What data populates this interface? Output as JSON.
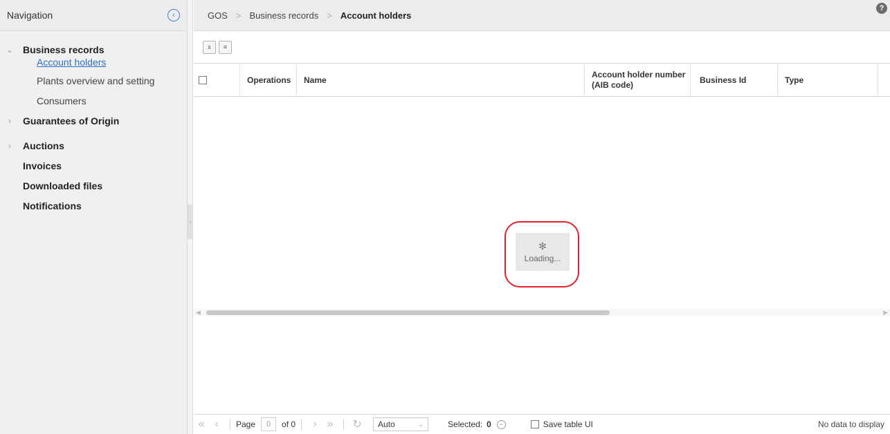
{
  "sidebar": {
    "title": "Navigation",
    "items": [
      {
        "label": "Business records",
        "expanded": true,
        "children": [
          "Account holders",
          "Plants overview and setting",
          "Consumers"
        ]
      },
      {
        "label": "Guarantees of Origin"
      },
      {
        "label": "Auctions"
      },
      {
        "label": "Invoices"
      },
      {
        "label": "Downloaded files"
      },
      {
        "label": "Notifications"
      }
    ]
  },
  "breadcrumb": [
    "GOS",
    "Business records",
    "Account holders"
  ],
  "grid": {
    "columns": [
      "Operations",
      "Name",
      "Account holder number (AIB code)",
      "Business Id",
      "Type"
    ],
    "loading_text": "Loading..."
  },
  "pager": {
    "page_label": "Page",
    "page_value": "0",
    "of_label": "of 0",
    "page_size": "Auto",
    "selected_label": "Selected:",
    "selected_count": "0",
    "save_ui_label": "Save table UI",
    "status": "No data to display"
  },
  "colors": {
    "accent": "#2f6fc9",
    "highlight": "#e0202b"
  }
}
